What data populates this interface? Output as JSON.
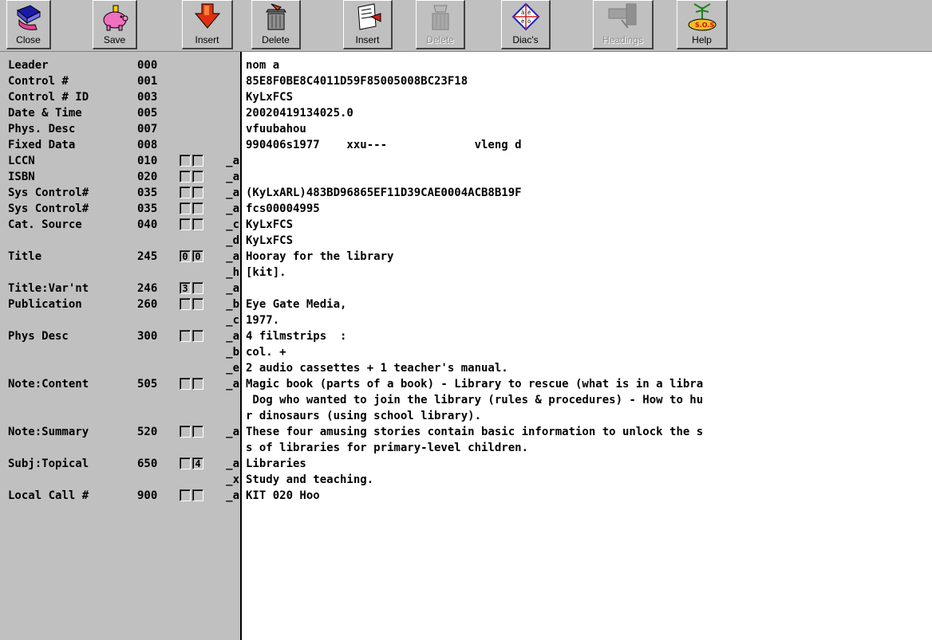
{
  "toolbar": [
    {
      "label": "Close",
      "icon": "close-book-icon",
      "disabled": false
    },
    {
      "label": "Save",
      "icon": "piggy-bank-icon",
      "disabled": false
    },
    {
      "label": "Insert",
      "icon": "insert-arrow-icon",
      "disabled": false
    },
    {
      "label": "Delete",
      "icon": "trash-can-icon",
      "disabled": false
    },
    {
      "label": "Insert",
      "icon": "insert-field-icon",
      "disabled": false
    },
    {
      "label": "Delete",
      "icon": "delete-field-icon",
      "disabled": true
    },
    {
      "label": "Diac's",
      "icon": "diacritics-icon",
      "disabled": false
    },
    {
      "label": "Headings",
      "icon": "headings-icon",
      "disabled": true
    },
    {
      "label": "Help",
      "icon": "sos-help-icon",
      "disabled": false
    }
  ],
  "fields": [
    {
      "label": "Leader",
      "tag": "000",
      "ind1": null,
      "ind2": null,
      "sub": "",
      "data": "nom a"
    },
    {
      "label": "Control #",
      "tag": "001",
      "ind1": null,
      "ind2": null,
      "sub": "",
      "data": "85E8F0BE8C4011D59F85005008BC23F18"
    },
    {
      "label": "Control # ID",
      "tag": "003",
      "ind1": null,
      "ind2": null,
      "sub": "",
      "data": "KyLxFCS"
    },
    {
      "label": "Date & Time",
      "tag": "005",
      "ind1": null,
      "ind2": null,
      "sub": "",
      "data": "20020419134025.0"
    },
    {
      "label": "Phys. Desc",
      "tag": "007",
      "ind1": null,
      "ind2": null,
      "sub": "",
      "data": "vfuubahou"
    },
    {
      "label": "Fixed Data",
      "tag": "008",
      "ind1": null,
      "ind2": null,
      "sub": "",
      "data": "990406s1977    xxu---             vleng d"
    },
    {
      "label": "LCCN",
      "tag": "010",
      "ind1": "",
      "ind2": "",
      "sub": "_a",
      "data": ""
    },
    {
      "label": "ISBN",
      "tag": "020",
      "ind1": "",
      "ind2": "",
      "sub": "_a",
      "data": ""
    },
    {
      "label": "Sys Control#",
      "tag": "035",
      "ind1": "",
      "ind2": "",
      "sub": "_a",
      "data": "(KyLxARL)483BD96865EF11D39CAE0004ACB8B19F"
    },
    {
      "label": "Sys Control#",
      "tag": "035",
      "ind1": "",
      "ind2": "",
      "sub": "_a",
      "data": "fcs00004995"
    },
    {
      "label": "Cat. Source",
      "tag": "040",
      "ind1": "",
      "ind2": "",
      "sub": "_c",
      "data": "KyLxFCS"
    },
    {
      "label": "",
      "tag": "",
      "ind1": null,
      "ind2": null,
      "sub": "_d",
      "data": "KyLxFCS"
    },
    {
      "label": "Title",
      "tag": "245",
      "ind1": "0",
      "ind2": "0",
      "sub": "_a",
      "data": "Hooray for the library"
    },
    {
      "label": "",
      "tag": "",
      "ind1": null,
      "ind2": null,
      "sub": "_h",
      "data": "[kit]."
    },
    {
      "label": "Title:Var'nt",
      "tag": "246",
      "ind1": "3",
      "ind2": "",
      "sub": "_a",
      "data": ""
    },
    {
      "label": "Publication",
      "tag": "260",
      "ind1": "",
      "ind2": "",
      "sub": "_b",
      "data": "Eye Gate Media,"
    },
    {
      "label": "",
      "tag": "",
      "ind1": null,
      "ind2": null,
      "sub": "_c",
      "data": "1977."
    },
    {
      "label": "Phys Desc",
      "tag": "300",
      "ind1": "",
      "ind2": "",
      "sub": "_a",
      "data": "4 filmstrips  :"
    },
    {
      "label": "",
      "tag": "",
      "ind1": null,
      "ind2": null,
      "sub": "_b",
      "data": "col. +"
    },
    {
      "label": "",
      "tag": "",
      "ind1": null,
      "ind2": null,
      "sub": "_e",
      "data": "2 audio cassettes + 1 teacher's manual."
    },
    {
      "label": "Note:Content",
      "tag": "505",
      "ind1": "",
      "ind2": "",
      "sub": "_a",
      "data": "Magic book (parts of a book) - Library to rescue (what is in a libra"
    },
    {
      "label": "",
      "tag": "",
      "ind1": null,
      "ind2": null,
      "sub": "",
      "data": " Dog who wanted to join the library (rules & procedures) - How to hu"
    },
    {
      "label": "",
      "tag": "",
      "ind1": null,
      "ind2": null,
      "sub": "",
      "data": "r dinosaurs (using school library)."
    },
    {
      "label": "Note:Summary",
      "tag": "520",
      "ind1": "",
      "ind2": "",
      "sub": "_a",
      "data": "These four amusing stories contain basic information to unlock the s"
    },
    {
      "label": "",
      "tag": "",
      "ind1": null,
      "ind2": null,
      "sub": "",
      "data": "s of libraries for primary-level children."
    },
    {
      "label": "Subj:Topical",
      "tag": "650",
      "ind1": "",
      "ind2": "4",
      "sub": "_a",
      "data": "Libraries"
    },
    {
      "label": "",
      "tag": "",
      "ind1": null,
      "ind2": null,
      "sub": "_x",
      "data": "Study and teaching."
    },
    {
      "label": "Local Call #",
      "tag": "900",
      "ind1": "",
      "ind2": "",
      "sub": "_a",
      "data": "KIT 020 Hoo"
    }
  ]
}
